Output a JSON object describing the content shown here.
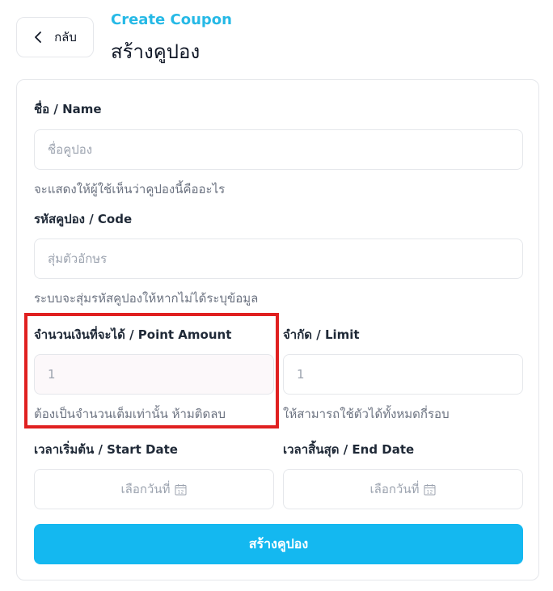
{
  "header": {
    "back_label": "กลับ",
    "subtitle": "Create Coupon",
    "title": "สร้างคูปอง"
  },
  "form": {
    "name": {
      "label": "ชื่อ / Name",
      "placeholder": "ชื่อคูปอง",
      "help": "จะแสดงให้ผู้ใช้เห็นว่าคูปองนี้คืออะไร"
    },
    "code": {
      "label": "รหัสคูปอง / Code",
      "placeholder": "สุ่มตัวอักษร",
      "help": "ระบบจะสุ่มรหัสคูปองให้หากไม่ได้ระบุข้อมูล"
    },
    "point_amount": {
      "label": "จำนวนเงินที่จะได้ / Point Amount",
      "placeholder": "1",
      "help": "ต้องเป็นจำนวนเต็มเท่านั้น ห้ามติดลบ"
    },
    "limit": {
      "label": "จำกัด / Limit",
      "placeholder": "1",
      "help": "ให้สามารถใช้ตัวได้ทั้งหมดกี่รอบ"
    },
    "start_date": {
      "label": "เวลาเริ่มต้น / Start Date",
      "placeholder": "เลือกวันที่"
    },
    "end_date": {
      "label": "เวลาสิ้นสุด / End Date",
      "placeholder": "เลือกวันที่"
    },
    "submit_label": "สร้างคูปอง"
  },
  "colors": {
    "accent": "#14b8f0",
    "subtitle": "#26b9e6",
    "highlight": "#e02020"
  }
}
